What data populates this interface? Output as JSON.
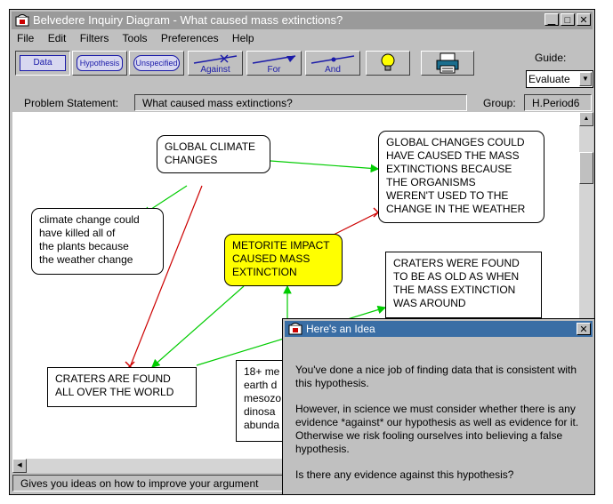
{
  "window": {
    "title": "Belvedere Inquiry Diagram - What caused mass extinctions?"
  },
  "menu": [
    "File",
    "Edit",
    "Filters",
    "Tools",
    "Preferences",
    "Help"
  ],
  "toolbar": {
    "data_label": "Data",
    "hypothesis_label": "Hypothesis",
    "unspecified_label": "Unspecified",
    "against_label": "Against",
    "for_label": "For",
    "and_label": "And"
  },
  "guide": {
    "label": "Guide:",
    "value": "Evaluate"
  },
  "problem": {
    "label": "Problem Statement:",
    "value": "What caused mass extinctions?"
  },
  "group": {
    "label": "Group:",
    "value": "H.Period6"
  },
  "nodes": {
    "global_climate": [
      "GLOBAL CLIMATE",
      "CHANGES"
    ],
    "global_changes": [
      "GLOBAL CHANGES COULD",
      "HAVE CAUSED THE MASS",
      "EXTINCTIONS BECAUSE",
      "THE ORGANISMS",
      "WEREN'T USED TO THE",
      "CHANGE IN THE WEATHER"
    ],
    "climate_change": [
      "climate change could",
      "have killed all of",
      "the plants because",
      "the weather change"
    ],
    "meteorite": [
      "METORITE IMPACT",
      "CAUSED MASS",
      "EXTINCTION"
    ],
    "craters_old": [
      "CRATERS WERE FOUND",
      "TO BE AS OLD AS WHEN",
      "THE MASS EXTINCTION",
      "WAS AROUND"
    ],
    "craters_found": [
      "CRATERS ARE FOUND",
      "ALL OVER THE WORLD"
    ],
    "partial": [
      "18+ me",
      "earth d",
      "mesozo",
      "dinosa",
      "abunda"
    ]
  },
  "status": "Gives you ideas on how to improve your argument",
  "popup": {
    "title": "Here's an Idea",
    "paragraphs": [
      "You've done a nice job of finding data that is consistent with this hypothesis.",
      "However, in science we must consider whether there is any evidence *against* our hypothesis as well as evidence for it. Otherwise we risk fooling ourselves into believing a false hypothesis.",
      "Is there any evidence against this hypothesis?"
    ]
  },
  "colors": {
    "for_link": "#00cc00",
    "against_link": "#cc0000",
    "hypothesis_fill": "#ffff00"
  }
}
